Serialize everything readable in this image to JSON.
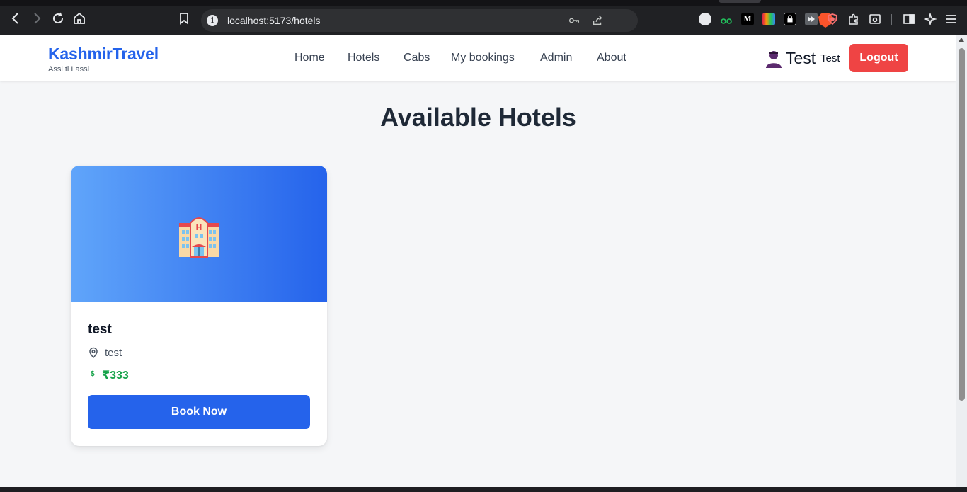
{
  "browser": {
    "url": "localhost:5173/hotels"
  },
  "navbar": {
    "brand": "KashmirTravel",
    "tagline": "Assi ti Lassi",
    "links": [
      "Home",
      "Hotels",
      "Cabs",
      "My bookings",
      "Admin",
      "About"
    ],
    "user_display": "Test",
    "user_name": "Test",
    "logout_label": "Logout"
  },
  "main": {
    "title": "Available Hotels",
    "hotels": [
      {
        "name": "test",
        "location": "test",
        "currency_icon": "$",
        "price": "₹333",
        "book_label": "Book Now",
        "hero_colors": [
          "#60a5fa",
          "#2563eb"
        ]
      }
    ]
  },
  "colors": {
    "brand": "#2463eb",
    "logout": "#ef4444",
    "price": "#16a34a",
    "primary_button": "#2563eb"
  }
}
